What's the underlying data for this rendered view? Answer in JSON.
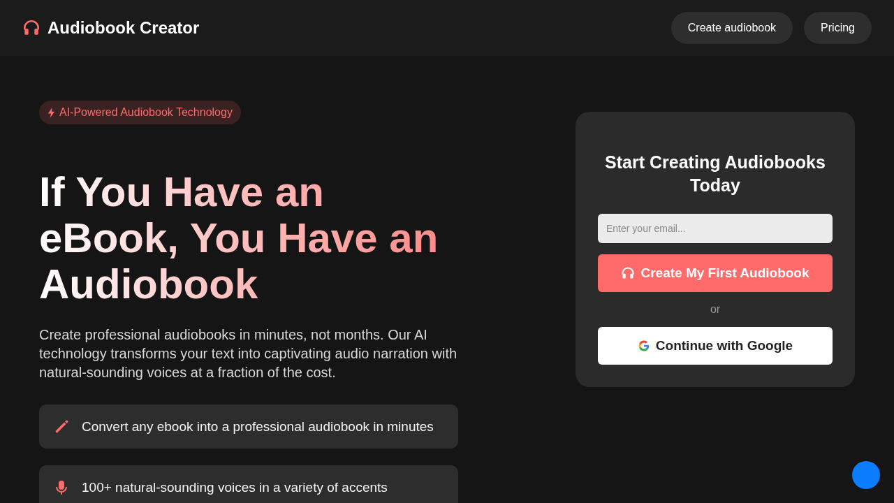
{
  "header": {
    "brand": "Audiobook Creator",
    "nav": [
      {
        "label": "Create audiobook"
      },
      {
        "label": "Pricing"
      }
    ]
  },
  "hero": {
    "badge": "AI-Powered Audiobook Technology",
    "headline": "If You Have an eBook, You Have an Audiobook",
    "description": "Create professional audiobooks in minutes, not months. Our AI technology transforms your text into captivating audio narration with natural-sounding voices at a fraction of the cost.",
    "features": [
      {
        "kind": "convert",
        "text": "Convert any ebook into a professional audiobook in minutes"
      },
      {
        "kind": "voices",
        "text": "100+ natural-sounding voices in a variety of accents"
      }
    ]
  },
  "signup": {
    "title": "Start Creating Audiobooks Today",
    "email_placeholder": "Enter your email...",
    "primary_button": "Create My First Audiobook",
    "divider": "or",
    "google_button": "Continue with Google"
  }
}
